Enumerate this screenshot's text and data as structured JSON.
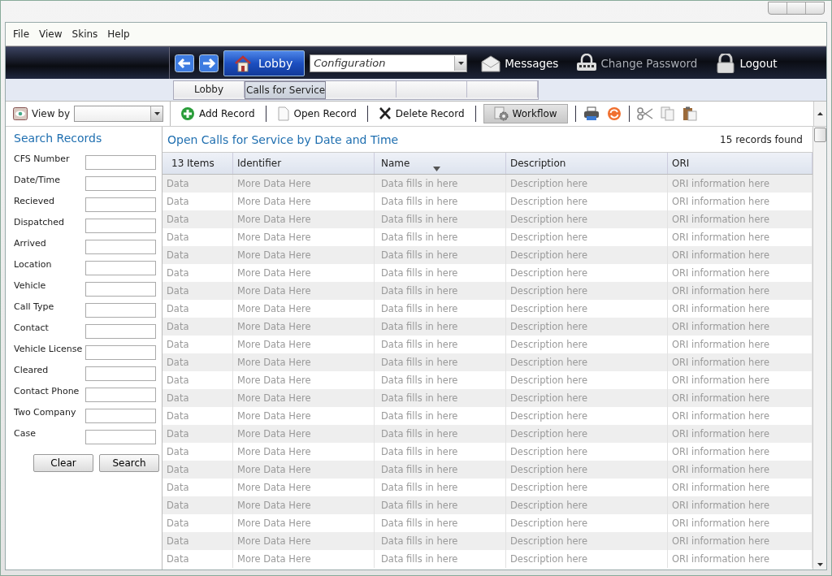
{
  "menu": [
    "File",
    "View",
    "Skins",
    "Help"
  ],
  "nav": {
    "lobby_button": "Lobby",
    "module_select": "Configuration",
    "links": [
      {
        "kind": "messages",
        "label": "Messages",
        "disabled": false
      },
      {
        "kind": "password",
        "label": "Change Password",
        "disabled": true
      },
      {
        "kind": "logout",
        "label": "Logout",
        "disabled": false
      }
    ]
  },
  "tabs": [
    {
      "label": "Lobby",
      "selected": false
    },
    {
      "label": "Calls for Service",
      "selected": true
    }
  ],
  "view_by": {
    "label": "View by"
  },
  "toolbar": [
    {
      "kind": "add",
      "label": "Add Record",
      "selected": false
    },
    {
      "kind": "open",
      "label": "Open Record",
      "selected": false
    },
    {
      "kind": "delete",
      "label": "Delete Record",
      "selected": false
    },
    {
      "kind": "workflow",
      "label": "Workflow",
      "selected": true
    }
  ],
  "search": {
    "title": "Search Records",
    "fields": [
      "CFS Number",
      "Date/Time",
      "Recieved",
      "Dispatched",
      "Arrived",
      "Location",
      "Vehicle",
      "Call Type",
      "Contact",
      "Vehicle License",
      "Cleared",
      "Contact Phone",
      "Two Company",
      "Case"
    ],
    "buttons": [
      "Clear",
      "Search"
    ]
  },
  "grid": {
    "title": "Open Calls for Service by Date and Time",
    "count": "15 records found",
    "columns": [
      {
        "label": "13 Items",
        "sorted": false
      },
      {
        "label": "Identifier",
        "sorted": false
      },
      {
        "label": "Name",
        "sorted": true
      },
      {
        "label": "Description",
        "sorted": false
      },
      {
        "label": "ORI",
        "sorted": false
      }
    ],
    "rows": [
      [
        "Data",
        "More Data Here",
        "Data fills in here",
        "Description here",
        "ORI information here"
      ],
      [
        "Data",
        "More Data Here",
        "Data fills in here",
        "Description here",
        "ORI information here"
      ],
      [
        "Data",
        "More Data Here",
        "Data fills in here",
        "Description here",
        "ORI information here"
      ],
      [
        "Data",
        "More Data Here",
        "Data fills in here",
        "Description here",
        "ORI information here"
      ],
      [
        "Data",
        "More Data Here",
        "Data fills in here",
        "Description here",
        "ORI information here"
      ],
      [
        "Data",
        "More Data Here",
        "Data fills in here",
        "Description here",
        "ORI information here"
      ],
      [
        "Data",
        "More Data Here",
        "Data fills in here",
        "Description here",
        "ORI information here"
      ],
      [
        "Data",
        "More Data Here",
        "Data fills in here",
        "Description here",
        "ORI information here"
      ],
      [
        "Data",
        "More Data Here",
        "Data fills in here",
        "Description here",
        "ORI information here"
      ],
      [
        "Data",
        "More Data Here",
        "Data fills in here",
        "Description here",
        "ORI information here"
      ],
      [
        "Data",
        "More Data Here",
        "Data fills in here",
        "Description here",
        "ORI information here"
      ],
      [
        "Data",
        "More Data Here",
        "Data fills in here",
        "Description here",
        "ORI information here"
      ],
      [
        "Data",
        "More Data Here",
        "Data fills in here",
        "Description here",
        "ORI information here"
      ],
      [
        "Data",
        "More Data Here",
        "Data fills in here",
        "Description here",
        "ORI information here"
      ],
      [
        "Data",
        "More Data Here",
        "Data fills in here",
        "Description here",
        "ORI information here"
      ],
      [
        "Data",
        "More Data Here",
        "Data fills in here",
        "Description here",
        "ORI information here"
      ],
      [
        "Data",
        "More Data Here",
        "Data fills in here",
        "Description here",
        "ORI information here"
      ],
      [
        "Data",
        "More Data Here",
        "Data fills in here",
        "Description here",
        "ORI information here"
      ],
      [
        "Data",
        "More Data Here",
        "Data fills in here",
        "Description here",
        "ORI information here"
      ],
      [
        "Data",
        "More Data Here",
        "Data fills in here",
        "Description here",
        "ORI information here"
      ],
      [
        "Data",
        "More Data Here",
        "Data fills in here",
        "Description here",
        "ORI information here"
      ],
      [
        "Data",
        "More Data Here",
        "Data fills in here",
        "Description here",
        "ORI information here"
      ]
    ]
  }
}
